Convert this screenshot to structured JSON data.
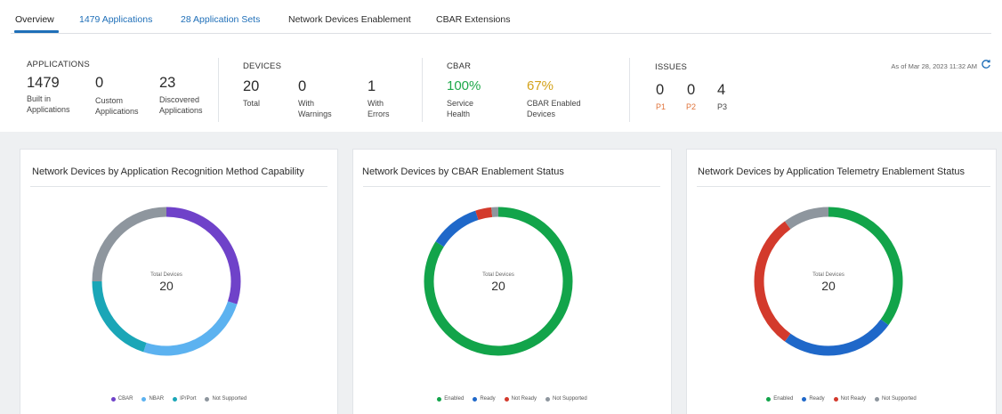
{
  "tabs": [
    {
      "label": "Overview"
    },
    {
      "count": "1479",
      "label": "Applications"
    },
    {
      "count": "28",
      "label": "Application Sets"
    },
    {
      "label": "Network Devices Enablement"
    },
    {
      "label": "CBAR Extensions"
    }
  ],
  "summary": {
    "applications": {
      "title": "APPLICATIONS",
      "stats": [
        {
          "value": "1479",
          "label": "Built in\nApplications"
        },
        {
          "value": "0",
          "label": "Custom\nApplications"
        },
        {
          "value": "23",
          "label": "Discovered\nApplications"
        }
      ]
    },
    "devices": {
      "title": "DEVICES",
      "stats": [
        {
          "value": "20",
          "label": "Total"
        },
        {
          "value": "0",
          "label": "With\nWarnings"
        },
        {
          "value": "1",
          "label": "With\nErrors"
        }
      ]
    },
    "cbar": {
      "title": "CBAR",
      "stats": [
        {
          "value": "100%",
          "label": "Service\nHealth"
        },
        {
          "value": "67%",
          "label": "CBAR Enabled\nDevices"
        }
      ]
    },
    "issues": {
      "title": "ISSUES",
      "stats": [
        {
          "value": "0",
          "label": "P1"
        },
        {
          "value": "0",
          "label": "P2"
        },
        {
          "value": "4",
          "label": "P3"
        }
      ]
    },
    "as_of": "As of Mar 28, 2023 11:32 AM"
  },
  "colors": {
    "accent": "#1f6fb8",
    "green_health": "#1ea84a",
    "gold": "#d4a21a",
    "issue_orange": "#e0733a"
  },
  "cards": [
    {
      "title": "Network Devices by Application Recognition Method Capability",
      "center_label": "Total Devices",
      "center_value": "20",
      "segments": [
        {
          "label": "CBAR",
          "value": 6,
          "color": "#6f42c9"
        },
        {
          "label": "NBAR",
          "value": 5,
          "color": "#5cb2f0"
        },
        {
          "label": "IP/Port",
          "value": 4,
          "color": "#1aa6b7"
        },
        {
          "label": "Not Supported",
          "value": 5,
          "color": "#8e969e"
        }
      ]
    },
    {
      "title": "Network Devices by CBAR Enablement Status",
      "center_label": "Total Devices",
      "center_value": "20",
      "segments": [
        {
          "label": "Enabled",
          "value": 16.8,
          "color": "#12a44a"
        },
        {
          "label": "Ready",
          "value": 2.2,
          "color": "#1f68c9"
        },
        {
          "label": "Not Ready",
          "value": 0.7,
          "color": "#d33a2c"
        },
        {
          "label": "Not Supported",
          "value": 0.3,
          "color": "#8e969e"
        }
      ]
    },
    {
      "title": "Network Devices by Application Telemetry Enablement Status",
      "center_label": "Total Devices",
      "center_value": "20",
      "segments": [
        {
          "label": "Enabled",
          "value": 7,
          "color": "#12a44a"
        },
        {
          "label": "Ready",
          "value": 5,
          "color": "#1f68c9"
        },
        {
          "label": "Not Ready",
          "value": 6,
          "color": "#d33a2c"
        },
        {
          "label": "Not Supported",
          "value": 2,
          "color": "#8e969e"
        }
      ]
    }
  ]
}
